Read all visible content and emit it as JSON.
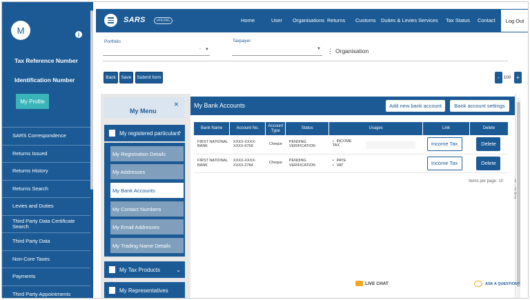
{
  "sidebar": {
    "avatar_letter": "M",
    "info_icon": "i",
    "tax_reference_label": "Tax Reference Number",
    "identification_label": "Identification Number",
    "my_profile_label": "My Profile",
    "items": [
      {
        "label": "SARS Correspondence"
      },
      {
        "label": "Returns Issued"
      },
      {
        "label": "Returns History"
      },
      {
        "label": "Returns Search"
      },
      {
        "label": "Levies and Duties"
      },
      {
        "label": "Third Party Data Certificate Search"
      },
      {
        "label": "Third Party Data"
      },
      {
        "label": "Non-Core Taxes"
      },
      {
        "label": "Payments"
      },
      {
        "label": "Third Party Appointments"
      }
    ]
  },
  "topnav": {
    "logo": "SARS",
    "logo_sub": "eFILING",
    "items": [
      "Home",
      "User",
      "Organisations",
      "Returns",
      "Customs",
      "Duties & Levies",
      "Services",
      "Tax Status",
      "Contact"
    ],
    "logout_label": "Log Out"
  },
  "filters": {
    "portfolio_label": "Portfolio",
    "portfolio_value": "-",
    "taxpayer_label": "Taxpayer",
    "organisation_label": "Organisation"
  },
  "actions": {
    "back_label": "Back",
    "save_label": "Save",
    "submit_label": "Submit form",
    "zoom_minus": "-",
    "zoom_value": "100",
    "zoom_plus": "+"
  },
  "menu": {
    "title": "My Menu",
    "close_icon": "×",
    "section_registered": "My registered particulars",
    "submenu": [
      {
        "label": "My Registration Details"
      },
      {
        "label": "My Addresses"
      },
      {
        "label": "My Bank Accounts"
      },
      {
        "label": "My Contact Numbers"
      },
      {
        "label": "My Email Addresses"
      },
      {
        "label": "My Trading Name Details"
      }
    ],
    "section_tax_products": "My Tax Products",
    "section_representatives": "My Representatives"
  },
  "bank": {
    "title": "My Bank Accounts",
    "add_button": "Add new bank account",
    "settings_button": "Bank account settings",
    "columns": [
      "Bank Name",
      "Account No.",
      "Account Type",
      "Status",
      "Usages",
      "Link",
      "Delete"
    ],
    "rows": [
      {
        "bank_name": "FIRST NATIONAL BANK",
        "account_no": "XXXX-XXXX-XXXX-9768",
        "account_type": "Cheque",
        "status": "PENDING VERIFICATION",
        "usages": [
          "INCOME TAX"
        ],
        "link_label": "Income Tax",
        "delete_label": "Delete"
      },
      {
        "bank_name": "FIRST NATIONAL BANK",
        "account_no": "XXXX-XXXX-XXXX-2784",
        "account_type": "Cheque",
        "status": "PENDING VERIFICATION",
        "usages": [
          "PAYE",
          "VAT"
        ],
        "link_label": "Income Tax",
        "delete_label": "Delete"
      }
    ],
    "items_per_page_label": "Items per page:",
    "items_per_page_value": "10",
    "range_label": "1 - 2 of 2"
  },
  "footer": {
    "live_chat": "LIVE CHAT",
    "ask": "ASK A QUESTION?"
  },
  "colors": {
    "brand": "#1b5a94",
    "accent": "#39b4b7",
    "chat": "#f5a623"
  }
}
